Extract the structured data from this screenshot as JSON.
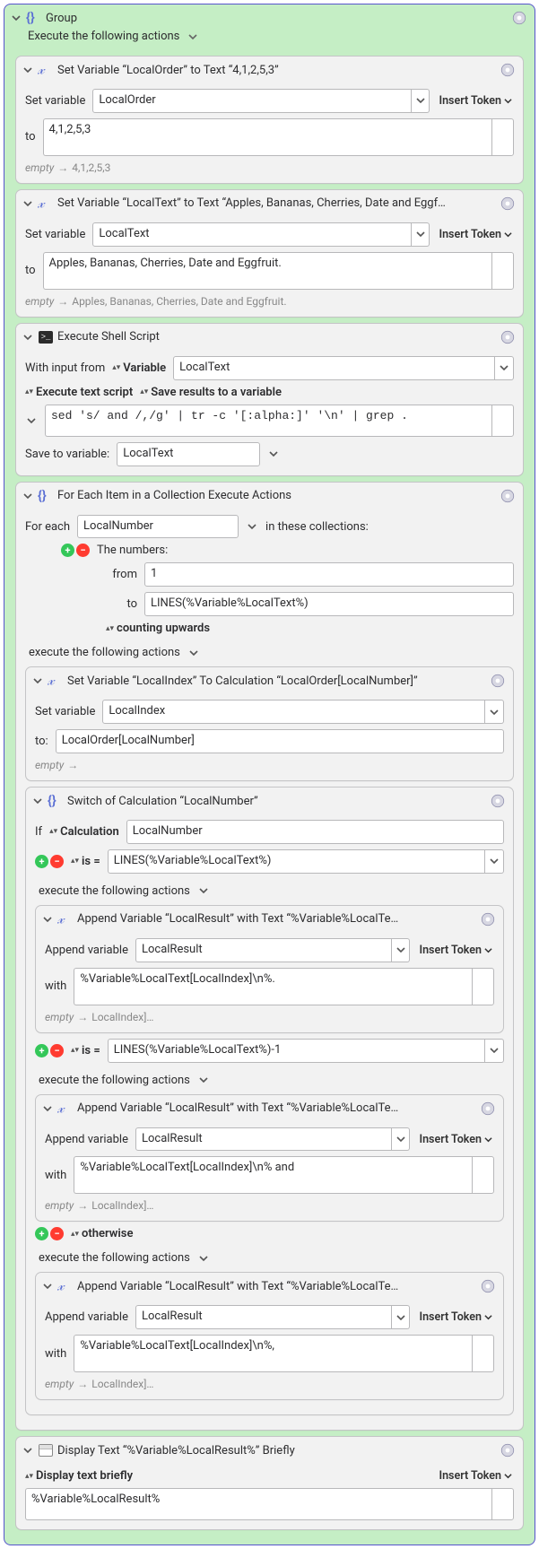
{
  "group": {
    "title": "Group",
    "subtitle": "Execute the following actions"
  },
  "tokens": {
    "insert_token": "Insert Token"
  },
  "set1": {
    "title": "Set Variable “LocalOrder” to Text “4,1,2,5,3”",
    "set_variable_label": "Set variable",
    "var_name": "LocalOrder",
    "to_label": "to",
    "value": "4,1,2,5,3",
    "preview_prefix": "empty",
    "preview_value": "4,1,2,5,3"
  },
  "set2": {
    "title": "Set Variable “LocalText” to Text “Apples, Bananas, Cherries, Date and Eggf…",
    "set_variable_label": "Set variable",
    "var_name": "LocalText",
    "to_label": "to",
    "value": "Apples, Bananas, Cherries, Date and Eggfruit.",
    "preview_prefix": "empty",
    "preview_value": "Apples, Bananas, Cherries, Date and Eggfruit."
  },
  "shell": {
    "title": "Execute Shell Script",
    "with_input_from": "With input from",
    "variable_label": "Variable",
    "input_var": "LocalText",
    "exec_label": "Execute text script",
    "save_mode": "Save results to a variable",
    "script": "sed 's/ and /,/g' | tr -c '[:alpha:]' '\\n' | grep .",
    "save_to_var_label": "Save to variable:",
    "save_to_var": "LocalText"
  },
  "loop": {
    "title": "For Each Item in a Collection Execute Actions",
    "foreach_label": "For each",
    "foreach_var": "LocalNumber",
    "in_label": "in these collections:",
    "numbers_label": "The numbers:",
    "from_label": "from",
    "from_value": "1",
    "to_label": "to",
    "to_value": "LINES(%Variable%LocalText%)",
    "counting_label": "counting upwards",
    "exec_label": "execute the following actions"
  },
  "setIndex": {
    "title": "Set Variable “LocalIndex” To Calculation “LocalOrder[LocalNumber]”",
    "set_variable_label": "Set variable",
    "var_name": "LocalIndex",
    "to_label": "to:",
    "value": "LocalOrder[LocalNumber]",
    "preview_prefix": "empty"
  },
  "switch": {
    "title": "Switch of Calculation “LocalNumber”",
    "if_label": "If",
    "calc_label": "Calculation",
    "calc_var": "LocalNumber",
    "is_label": "is =",
    "case1_value": "LINES(%Variable%LocalText%)",
    "case2_value": "LINES(%Variable%LocalText%)-1",
    "otherwise_label": "otherwise",
    "exec_label": "execute the following actions"
  },
  "append1": {
    "title": "Append Variable “LocalResult” with Text “%Variable%LocalTe…",
    "append_label": "Append variable",
    "var_name": "LocalResult",
    "with_label": "with",
    "value": "%Variable%LocalText[LocalIndex]\\n%.",
    "preview_prefix": "empty",
    "preview_value": "LocalIndex]…"
  },
  "append2": {
    "title": "Append Variable “LocalResult” with Text “%Variable%LocalTe…",
    "append_label": "Append variable",
    "var_name": "LocalResult",
    "with_label": "with",
    "value": "%Variable%LocalText[LocalIndex]\\n% and ",
    "preview_prefix": "empty",
    "preview_value": "LocalIndex]…"
  },
  "append3": {
    "title": "Append Variable “LocalResult” with Text “%Variable%LocalTe…",
    "append_label": "Append variable",
    "var_name": "LocalResult",
    "with_label": "with",
    "value": "%Variable%LocalText[LocalIndex]\\n%, ",
    "preview_prefix": "empty",
    "preview_value": "LocalIndex]…"
  },
  "display": {
    "title": "Display Text “%Variable%LocalResult%” Briefly",
    "mode_label": "Display text briefly",
    "value": "%Variable%LocalResult%"
  }
}
